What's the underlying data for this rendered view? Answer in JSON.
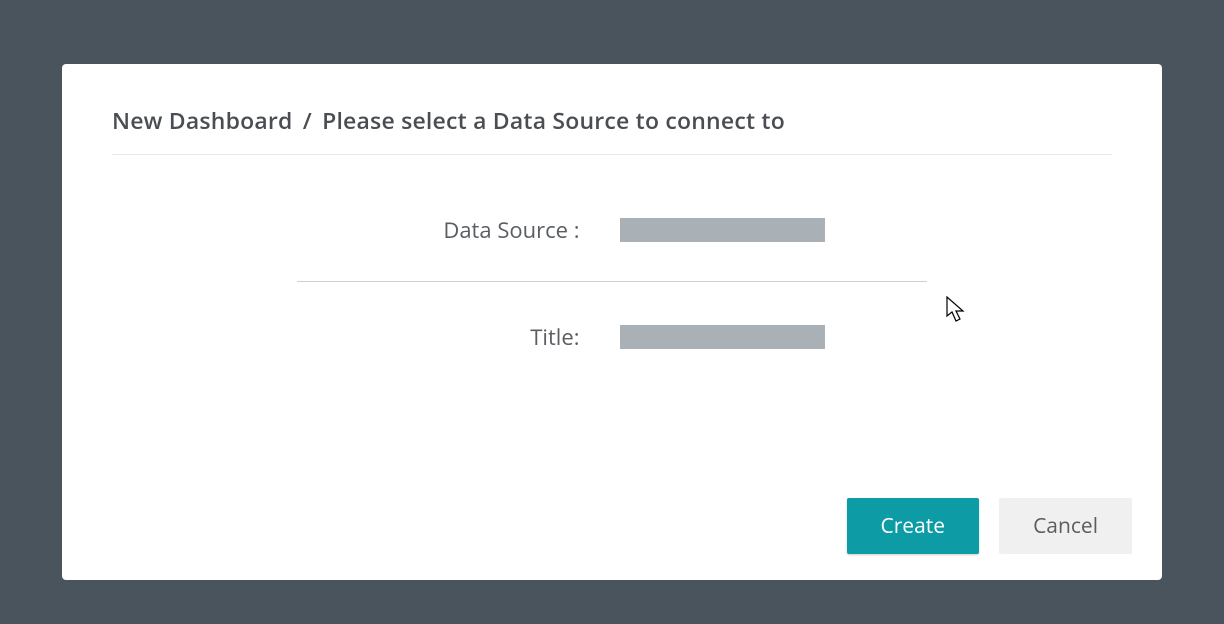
{
  "dialog": {
    "breadcrumb_dashboard": "New Dashboard",
    "breadcrumb_separator": "/",
    "breadcrumb_instruction": "Please select a Data Source to connect to"
  },
  "form": {
    "data_source_label": "Data Source :",
    "data_source_value": "",
    "title_label": "Title:",
    "title_value": ""
  },
  "buttons": {
    "create": "Create",
    "cancel": "Cancel"
  },
  "colors": {
    "background": "#4a545c",
    "dialog_bg": "#ffffff",
    "primary": "#0d9ba5",
    "secondary_bg": "#f0f0f0",
    "text_dark": "#4a4e52",
    "text_muted": "#5a5e62",
    "field_gray": "#a9b0b6"
  }
}
